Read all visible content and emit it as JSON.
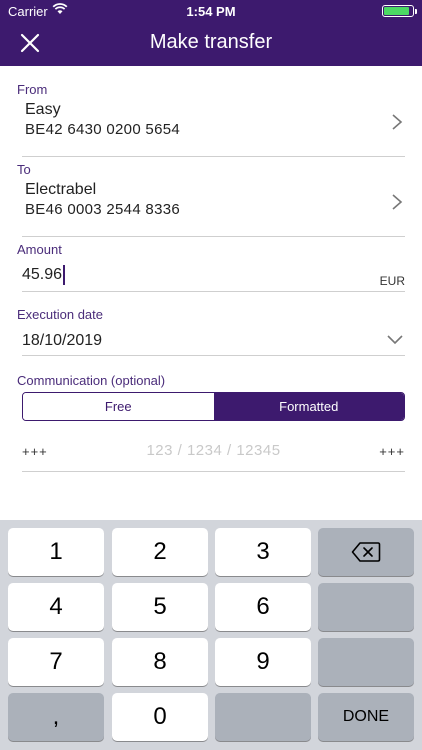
{
  "status_bar": {
    "carrier": "Carrier",
    "time": "1:54 PM",
    "battery_level": 0.9
  },
  "header": {
    "title": "Make transfer",
    "close_icon": "close-icon",
    "background_color": "#3d1a6e"
  },
  "form": {
    "from": {
      "label": "From",
      "account_name": "Easy",
      "iban": "BE42 6430 0200 5654"
    },
    "to": {
      "label": "To",
      "account_name": "Electrabel",
      "iban": "BE46 0003 2544 8336"
    },
    "amount": {
      "label": "Amount",
      "value": "45.96",
      "currency": "EUR"
    },
    "execution_date": {
      "label": "Execution date",
      "value": "18/10/2019"
    },
    "communication": {
      "label": "Communication (optional)",
      "options": [
        "Free",
        "Formatted"
      ],
      "selected": "Formatted",
      "prefix": "+++",
      "suffix": "+++",
      "placeholder": "123 / 1234 / 12345"
    }
  },
  "keyboard": {
    "keys": [
      "1",
      "2",
      "3",
      "4",
      "5",
      "6",
      "7",
      "8",
      "9",
      ",",
      "0"
    ],
    "done_label": "DONE",
    "delete_icon": "backspace-icon"
  }
}
